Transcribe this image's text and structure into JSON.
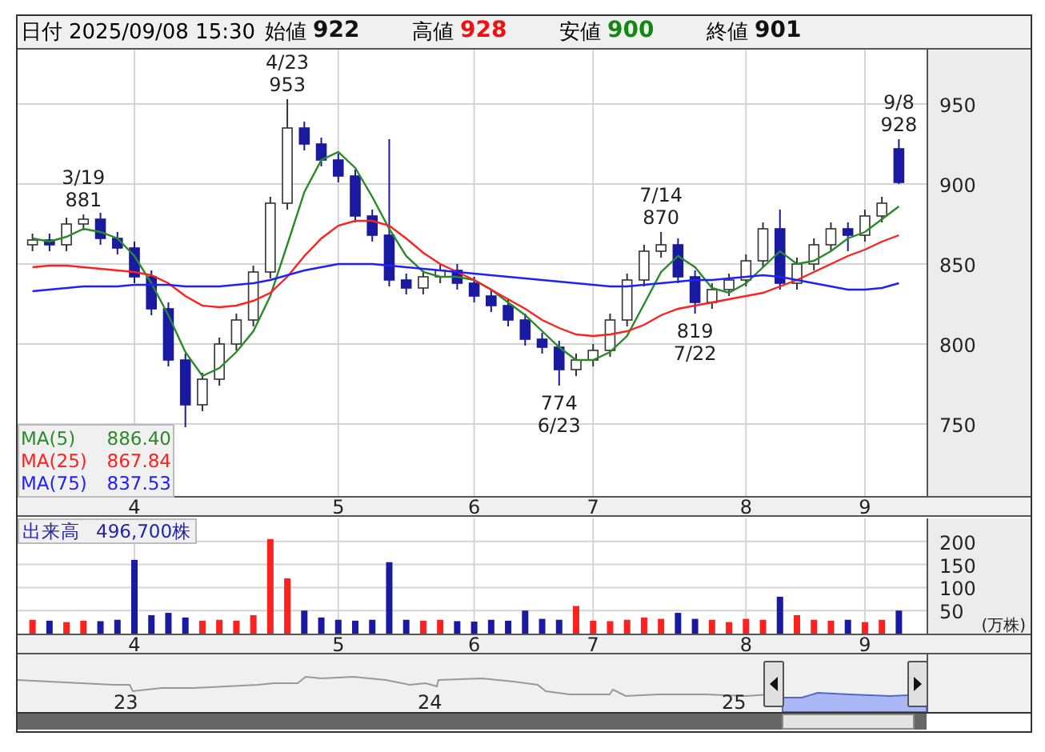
{
  "header": {
    "date_label": "日付",
    "date": "2025/09/08 15:30",
    "fields": [
      {
        "label": "始値",
        "value": "922",
        "kind": "open"
      },
      {
        "label": "高値",
        "value": "928",
        "kind": "high"
      },
      {
        "label": "安値",
        "value": "900",
        "kind": "low"
      },
      {
        "label": "終値",
        "value": "901",
        "kind": "close"
      }
    ]
  },
  "price_chart": {
    "chart_data": {
      "type": "candlestick",
      "ylim": [
        705,
        984
      ],
      "yticks": [
        {
          "value": 750,
          "label": "750"
        },
        {
          "value": 800,
          "label": "800"
        },
        {
          "value": 850,
          "label": "850"
        },
        {
          "value": 900,
          "label": "900"
        },
        {
          "value": 950,
          "label": "950"
        }
      ],
      "categories": [
        null,
        null,
        null,
        null,
        null,
        null,
        "4",
        null,
        null,
        null,
        null,
        null,
        null,
        null,
        null,
        null,
        null,
        null,
        "5",
        null,
        null,
        null,
        null,
        null,
        null,
        null,
        "6",
        null,
        null,
        null,
        null,
        null,
        null,
        "7",
        null,
        null,
        null,
        null,
        null,
        null,
        null,
        null,
        "8",
        null,
        null,
        null,
        null,
        null,
        null,
        "9",
        null,
        null
      ],
      "ohlc": [
        [
          862,
          869,
          858,
          865
        ],
        [
          865,
          869,
          858,
          862
        ],
        [
          862,
          879,
          858,
          875
        ],
        [
          875,
          881,
          871,
          878
        ],
        [
          878,
          882,
          862,
          866
        ],
        [
          866,
          870,
          856,
          860
        ],
        [
          860,
          864,
          838,
          842
        ],
        [
          842,
          846,
          818,
          822
        ],
        [
          822,
          826,
          786,
          790
        ],
        [
          790,
          794,
          748,
          762
        ],
        [
          762,
          782,
          758,
          778
        ],
        [
          778,
          804,
          774,
          800
        ],
        [
          800,
          819,
          796,
          815
        ],
        [
          815,
          849,
          811,
          845
        ],
        [
          845,
          892,
          841,
          888
        ],
        [
          888,
          953,
          884,
          935
        ],
        [
          935,
          939,
          921,
          925
        ],
        [
          925,
          929,
          911,
          915
        ],
        [
          915,
          919,
          901,
          905
        ],
        [
          905,
          909,
          876,
          880
        ],
        [
          880,
          884,
          864,
          868
        ],
        [
          868,
          928,
          836,
          840
        ],
        [
          840,
          844,
          831,
          835
        ],
        [
          835,
          846,
          831,
          842
        ],
        [
          842,
          850,
          838,
          846
        ],
        [
          846,
          850,
          834,
          838
        ],
        [
          838,
          842,
          826,
          830
        ],
        [
          830,
          834,
          820,
          824
        ],
        [
          824,
          828,
          811,
          815
        ],
        [
          815,
          819,
          799,
          803
        ],
        [
          803,
          807,
          794,
          798
        ],
        [
          798,
          802,
          774,
          784
        ],
        [
          784,
          794,
          780,
          790
        ],
        [
          790,
          800,
          786,
          796
        ],
        [
          796,
          819,
          792,
          815
        ],
        [
          815,
          844,
          811,
          840
        ],
        [
          840,
          862,
          836,
          858
        ],
        [
          858,
          870,
          854,
          862
        ],
        [
          862,
          866,
          838,
          842
        ],
        [
          842,
          846,
          819,
          826
        ],
        [
          826,
          838,
          822,
          834
        ],
        [
          834,
          844,
          830,
          840
        ],
        [
          840,
          856,
          836,
          852
        ],
        [
          852,
          876,
          848,
          872
        ],
        [
          872,
          884,
          834,
          838
        ],
        [
          838,
          854,
          834,
          850
        ],
        [
          850,
          866,
          846,
          862
        ],
        [
          862,
          876,
          858,
          872
        ],
        [
          872,
          876,
          858,
          868
        ],
        [
          868,
          884,
          864,
          880
        ],
        [
          880,
          892,
          876,
          888
        ],
        [
          922,
          928,
          900,
          901
        ]
      ],
      "series": [
        {
          "name": "MA(5)",
          "type": "line",
          "color": "#2a8a2a",
          "values": [
            866,
            864,
            867,
            872,
            870,
            866,
            855,
            838,
            818,
            795,
            780,
            785,
            795,
            808,
            830,
            862,
            895,
            915,
            920,
            910,
            892,
            872,
            855,
            845,
            842,
            842,
            840,
            834,
            826,
            818,
            808,
            798,
            790,
            790,
            795,
            805,
            825,
            845,
            855,
            848,
            835,
            832,
            838,
            848,
            858,
            850,
            852,
            858,
            866,
            870,
            878,
            886
          ]
        },
        {
          "name": "MA(25)",
          "type": "line",
          "color": "#ff2020",
          "values": [
            848,
            849,
            849,
            848,
            847,
            846,
            845,
            843,
            838,
            830,
            824,
            823,
            824,
            827,
            832,
            842,
            855,
            866,
            874,
            877,
            877,
            874,
            866,
            857,
            850,
            845,
            840,
            834,
            828,
            822,
            815,
            810,
            806,
            805,
            806,
            808,
            812,
            818,
            822,
            824,
            826,
            828,
            830,
            832,
            836,
            840,
            845,
            850,
            855,
            859,
            864,
            868
          ]
        },
        {
          "name": "MA(75)",
          "type": "line",
          "color": "#2020ff",
          "values": [
            833,
            834,
            835,
            836,
            836,
            836,
            837,
            837,
            837,
            836,
            836,
            836,
            837,
            838,
            840,
            843,
            846,
            848,
            850,
            850,
            850,
            849,
            848,
            847,
            846,
            845,
            844,
            843,
            842,
            841,
            840,
            839,
            838,
            837,
            836,
            836,
            837,
            838,
            839,
            840,
            840,
            841,
            842,
            843,
            842,
            840,
            838,
            836,
            834,
            834,
            835,
            838
          ]
        }
      ],
      "annotations": [
        "3/19\n881",
        "4/23\n953",
        "7/14\n870",
        "9/8\n928",
        "774\n6/23",
        "819\n7/22"
      ],
      "grid": true
    },
    "legend_values": [
      "886.40",
      "867.84",
      "837.53"
    ]
  },
  "volume_chart": {
    "total": "496,700株",
    "unit": "(万株)",
    "chart_data": {
      "type": "bar",
      "ylim": [
        0,
        250
      ],
      "grid": true,
      "yticks": [
        {
          "value": 50,
          "label": "50"
        },
        {
          "value": 100,
          "label": "100"
        },
        {
          "value": 150,
          "label": "150"
        },
        {
          "value": 200,
          "label": "200"
        }
      ],
      "categories": [
        null,
        null,
        null,
        null,
        null,
        null,
        "4",
        null,
        null,
        null,
        null,
        null,
        null,
        null,
        null,
        null,
        null,
        null,
        "5",
        null,
        null,
        null,
        null,
        null,
        null,
        null,
        "6",
        null,
        null,
        null,
        null,
        null,
        null,
        "7",
        null,
        null,
        null,
        null,
        null,
        null,
        null,
        null,
        "8",
        null,
        null,
        null,
        null,
        null,
        null,
        "9",
        null,
        null
      ],
      "series": [
        {
          "name": "出来高",
          "values": [
            30,
            28,
            25,
            28,
            27,
            30,
            160,
            40,
            45,
            35,
            28,
            30,
            28,
            40,
            205,
            120,
            50,
            35,
            30,
            28,
            30,
            155,
            30,
            28,
            30,
            27,
            26,
            30,
            28,
            50,
            32,
            30,
            60,
            28,
            27,
            30,
            35,
            32,
            45,
            32,
            30,
            25,
            32,
            30,
            80,
            40,
            30,
            28,
            30,
            25,
            30,
            50
          ]
        }
      ]
    }
  },
  "navigator": {
    "year_labels": [
      "23",
      "24",
      "25"
    ]
  }
}
